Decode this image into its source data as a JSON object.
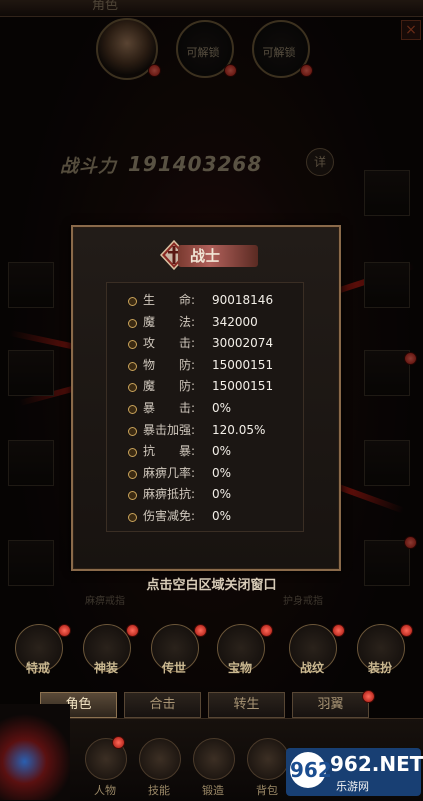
{
  "header": {
    "top_tab": "角色",
    "close": "×"
  },
  "slots": [
    {
      "label": ""
    },
    {
      "label": "可解锁"
    },
    {
      "label": "可解锁"
    }
  ],
  "combat": {
    "label": "战斗力",
    "value": "191403268",
    "detail_button": "详"
  },
  "popup": {
    "class_name": "战士",
    "stats": [
      {
        "label": "生　　命:",
        "value": "90018146"
      },
      {
        "label": "魔　　法:",
        "value": "342000"
      },
      {
        "label": "攻　　击:",
        "value": "30002074"
      },
      {
        "label": "物　　防:",
        "value": "15000151"
      },
      {
        "label": "魔　　防:",
        "value": "15000151"
      },
      {
        "label": "暴　　击:",
        "value": "0%"
      },
      {
        "label": "暴击加强:",
        "value": "120.05%"
      },
      {
        "label": "抗　　暴:",
        "value": "0%"
      },
      {
        "label": "麻痹几率:",
        "value": "0%"
      },
      {
        "label": "麻痹抵抗:",
        "value": "0%"
      },
      {
        "label": "伤害减免:",
        "value": "0%"
      }
    ],
    "close_hint": "点击空白区域关闭窗口"
  },
  "equip_captions": {
    "left": "麻痹戒指",
    "right": "护身戒指"
  },
  "features": [
    {
      "label": "特戒"
    },
    {
      "label": "神装"
    },
    {
      "label": "传世"
    },
    {
      "label": "宝物"
    },
    {
      "label": "战纹"
    },
    {
      "label": "装扮"
    }
  ],
  "tabs": [
    {
      "label": "角色",
      "active": true
    },
    {
      "label": "合击",
      "active": false
    },
    {
      "label": "转生",
      "active": false
    },
    {
      "label": "羽翼",
      "active": false
    }
  ],
  "bottom_nav": [
    {
      "label": "人物"
    },
    {
      "label": "技能"
    },
    {
      "label": "锻造"
    },
    {
      "label": "背包"
    }
  ],
  "watermark": {
    "logo": "962",
    "brand": "962.NET",
    "sub": "乐游网"
  },
  "colors": {
    "panel_border": "#8a6a4a",
    "stat_value": "#f3efe8",
    "accent_red": "#b0201a"
  }
}
